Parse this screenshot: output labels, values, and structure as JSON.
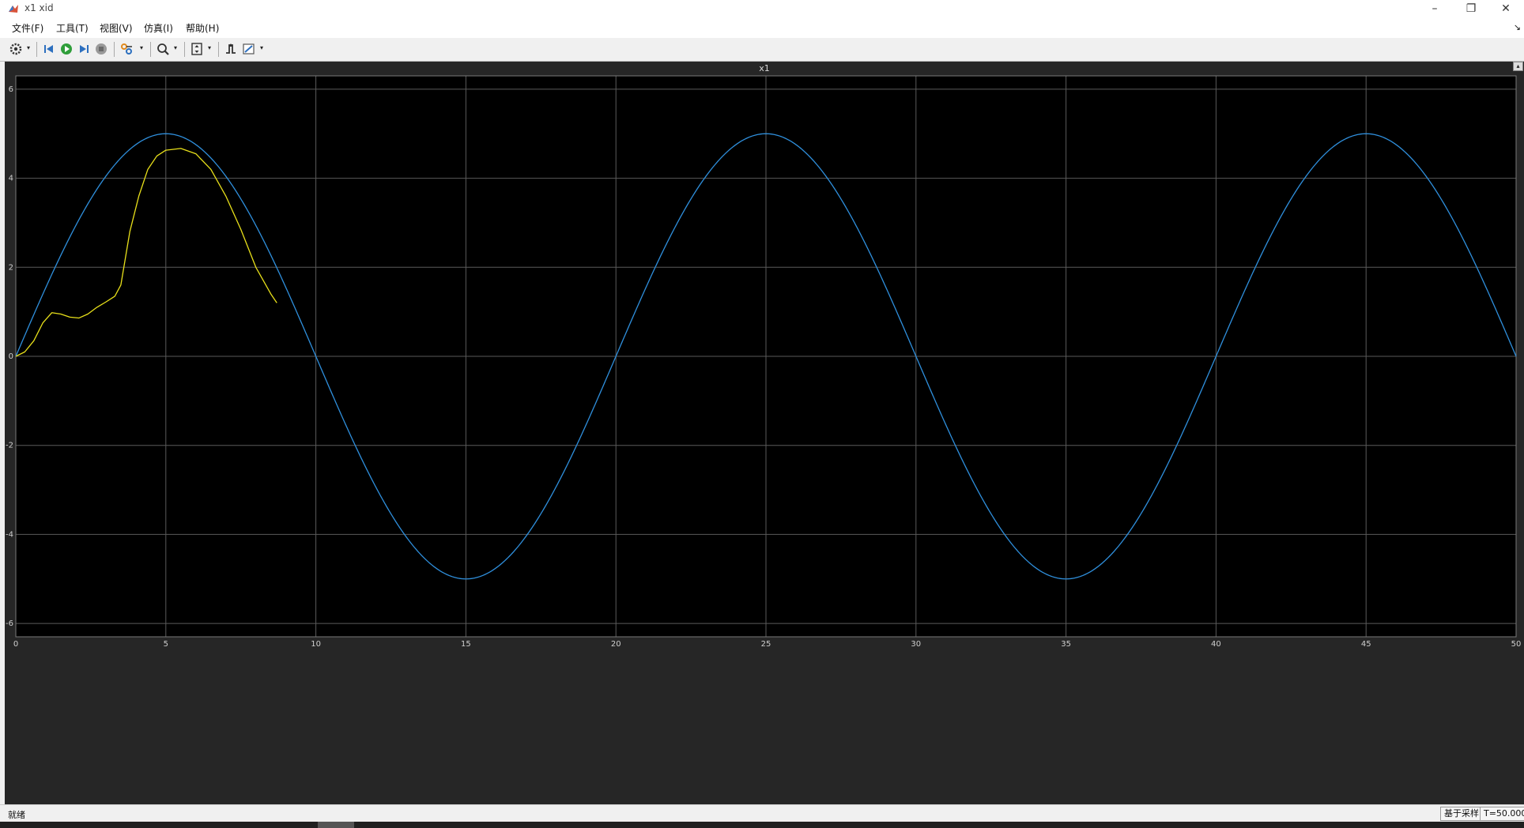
{
  "window": {
    "title": "x1 xid",
    "minimize_glyph": "–",
    "restore_glyph": "❐",
    "close_glyph": "✕"
  },
  "menu": {
    "items": [
      {
        "label": "文件(F)"
      },
      {
        "label": "工具(T)"
      },
      {
        "label": "视图(V)"
      },
      {
        "label": "仿真(I)"
      },
      {
        "label": "帮助(H)"
      }
    ],
    "arrow_glyph": "↘"
  },
  "toolbar": {
    "icons": [
      "settings-gear-icon",
      "step-back-icon",
      "run-icon",
      "step-forward-icon",
      "stop-icon",
      "signal-selector-icon",
      "zoom-icon",
      "autoscale-icon",
      "triggers-icon",
      "measurements-icon"
    ]
  },
  "scope": {
    "expand_glyph": "▴"
  },
  "chart_data": {
    "type": "line",
    "title": "x1",
    "xlim": [
      0,
      50
    ],
    "ylim": [
      -6.3,
      6.3
    ],
    "xticks": [
      0,
      5,
      10,
      15,
      20,
      25,
      30,
      35,
      40,
      45,
      50
    ],
    "yticks": [
      -6,
      -4,
      -2,
      0,
      2,
      4,
      6
    ],
    "grid": true,
    "background": "#000000",
    "axis_frame": "#262626",
    "grid_color": "#5a5a5a",
    "series": [
      {
        "color": "#2f8fdc",
        "function": "5*sin(0.1*pi*t)",
        "x": [
          0,
          2.5,
          5,
          7.5,
          10,
          12.5,
          15,
          17.5,
          20,
          22.5,
          25,
          27.5,
          30,
          32.5,
          35,
          37.5,
          40,
          42.5,
          45,
          47.5,
          50
        ],
        "y": [
          0,
          3.54,
          5,
          3.54,
          0,
          -3.54,
          -5,
          -3.54,
          0,
          3.54,
          5,
          3.54,
          0,
          -3.54,
          -5,
          -3.54,
          0,
          3.54,
          5,
          3.54,
          0
        ]
      },
      {
        "color": "#e8e01a",
        "x": [
          0,
          0.3,
          0.6,
          0.9,
          1.2,
          1.5,
          1.8,
          2.1,
          2.4,
          2.7,
          3.0,
          3.3,
          3.5,
          3.8,
          4.1,
          4.4,
          4.7,
          5.0,
          5.5,
          6.0,
          6.5,
          7.0,
          7.5,
          8.0,
          8.5,
          8.7
        ],
        "y": [
          0,
          0.1,
          0.35,
          0.75,
          0.98,
          0.95,
          0.88,
          0.86,
          0.95,
          1.1,
          1.22,
          1.35,
          1.6,
          2.8,
          3.6,
          4.2,
          4.5,
          4.63,
          4.67,
          4.55,
          4.2,
          3.6,
          2.85,
          2.0,
          1.4,
          1.2
        ],
        "merge_with_series_0_after": 8.7
      }
    ]
  },
  "status": {
    "left": "就绪",
    "sample_mode": "基于采样",
    "time": "T=50.000"
  }
}
